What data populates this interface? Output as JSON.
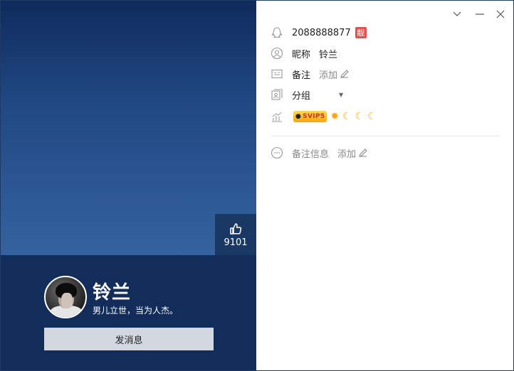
{
  "profile": {
    "name": "铃兰",
    "signature": "男儿立世，当为人杰。",
    "send_message_label": "发消息",
    "like_count": "9101"
  },
  "info": {
    "qq_number": "2088888877",
    "pretty_badge": "靓",
    "nickname_label": "昵称",
    "nickname_value": "铃兰",
    "remark_label": "备注",
    "remark_add": "添加",
    "group_label": "分组",
    "vip_badge": "SVIP5",
    "level_icons": [
      "sun-icon",
      "moon-icon",
      "moon-icon",
      "moon-icon"
    ],
    "remark_info_label": "备注信息",
    "remark_info_add": "添加"
  },
  "colors": {
    "panel_top": "#0f2a5c",
    "panel_bottom": "#122d59",
    "badge_red": "#e84c4c",
    "button_bg": "#d3d8e0"
  }
}
